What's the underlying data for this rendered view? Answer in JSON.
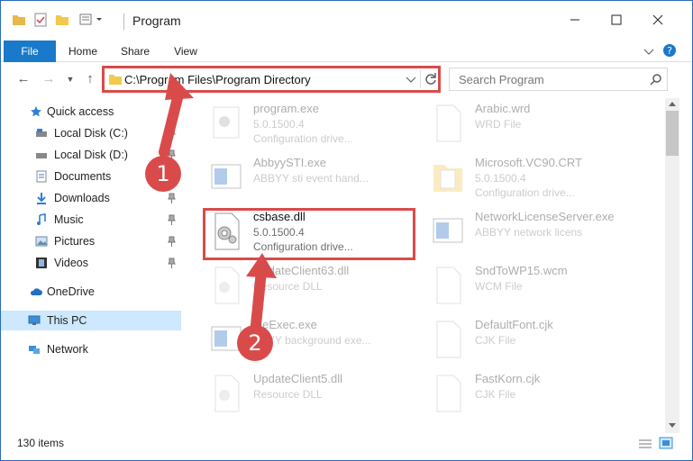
{
  "window": {
    "title": "Program"
  },
  "ribbon": {
    "tabs": [
      "File",
      "Home",
      "Share",
      "View"
    ]
  },
  "address": {
    "path": "C:\\Program Files\\Program Directory"
  },
  "search": {
    "placeholder": "Search Program"
  },
  "sidebar": {
    "items": [
      {
        "label": "Quick access",
        "icon": "star-icon"
      },
      {
        "label": "Local Disk (C:)",
        "icon": "drive-icon"
      },
      {
        "label": "Local Disk (D:)",
        "icon": "drive-icon"
      },
      {
        "label": "Documents",
        "icon": "documents-icon"
      },
      {
        "label": "Downloads",
        "icon": "download-icon"
      },
      {
        "label": "Music",
        "icon": "music-icon"
      },
      {
        "label": "Pictures",
        "icon": "pictures-icon"
      },
      {
        "label": "Videos",
        "icon": "videos-icon"
      },
      {
        "label": "OneDrive",
        "icon": "cloud-icon"
      },
      {
        "label": "This PC",
        "icon": "pc-icon"
      },
      {
        "label": "Network",
        "icon": "network-icon"
      }
    ]
  },
  "files": [
    {
      "name": "program.exe",
      "line1": "5.0.1500.4",
      "line2": "Configuration drive..."
    },
    {
      "name": "Arabic.wrd",
      "line1": "WRD File",
      "line2": ""
    },
    {
      "name": "AbbyySTI.exe",
      "line1": "ABBYY sti event hand...",
      "line2": ""
    },
    {
      "name": "Microsoft.VC90.CRT",
      "line1": "5.0.1500.4",
      "line2": "Configuration drive..."
    },
    {
      "name": "csbase.dll",
      "line1": "5.0.1500.4",
      "line2": "Configuration drive..."
    },
    {
      "name": "NetworkLicenseServer.exe",
      "line1": "ABBYY network licens",
      "line2": ""
    },
    {
      "name": "UpdateClient63.dll",
      "line1": "Resource DLL",
      "line2": ""
    },
    {
      "name": "SndToWP15.wcm",
      "line1": "WCM File",
      "line2": ""
    },
    {
      "name": "ineExec.exe",
      "line1": "BBYY background exe...",
      "line2": ""
    },
    {
      "name": "DefaultFont.cjk",
      "line1": "CJK File",
      "line2": ""
    },
    {
      "name": "UpdateClient5.dll",
      "line1": "Resource DLL",
      "line2": ""
    },
    {
      "name": "FastKorn.cjk",
      "line1": "CJK File",
      "line2": ""
    }
  ],
  "status": {
    "count": "130 items"
  },
  "annotations": {
    "step1": "1",
    "step2": "2"
  },
  "colors": {
    "accent": "#1979ca",
    "highlight": "#d94b4b",
    "selected": "#cde8ff"
  }
}
